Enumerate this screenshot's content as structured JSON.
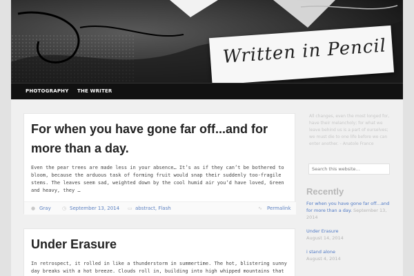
{
  "site": {
    "logo_text": "Written in Pencil"
  },
  "nav": {
    "items": [
      {
        "label": "PHOTOGRAPHY"
      },
      {
        "label": "THE WRITER"
      }
    ]
  },
  "posts": [
    {
      "title": "For when you have gone far off...and for more than a day.",
      "excerpt": "Even the pear trees are made less in your absence… It’s as if they can’t be bothered to bloom, because the arduous task of forming fruit would snap their suddenly too-fragile stems. The leaves seem sad, weighted down by the cool humid air you’d have loved, Green and heavy, they …",
      "author": "Gray",
      "date": "September 13, 2014",
      "categories": "abstract, Flash",
      "permalink_label": "Permalink"
    },
    {
      "title": "Under Erasure",
      "excerpt": "In retrospect, it rolled in like a thunderstorm in summertime. The hot, blistering sunny day breaks with a hot breeze. Clouds roll in, building into high whipped mountains that lay"
    }
  ],
  "sidebar": {
    "quote": "All changes, even the most longed for, have their melancholy; for what we leave behind us is a part of ourselves; we must die to one life before we can enter another. - Anatole France",
    "search_placeholder": "Search this website…",
    "recent_heading": "Recently",
    "recent": [
      {
        "title": "For when you have gone far off…and for more than a day.",
        "date": "September 13, 2014"
      },
      {
        "title": "Under Erasure",
        "date": "August 14, 2014"
      },
      {
        "title": "i stand alone",
        "date": "August 4, 2014"
      }
    ]
  },
  "icons": {
    "author": "person-icon",
    "date": "clock-icon",
    "categories": "folder-icon",
    "permalink": "link-icon"
  },
  "colors": {
    "link": "#5a7fc0",
    "nav_bg": "#111111",
    "page_bg": "#f0f0f0"
  }
}
